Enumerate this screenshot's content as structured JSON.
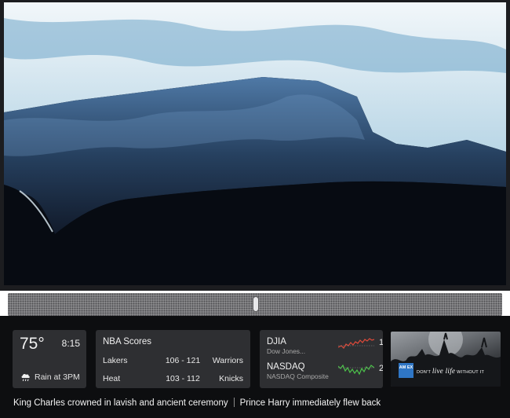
{
  "weather": {
    "temperature": "75°",
    "time": "8:15",
    "forecast": "Rain at 3PM",
    "icon": "rain-cloud-icon"
  },
  "nba": {
    "title": "NBA Scores",
    "games": [
      {
        "home": "Lakers",
        "score": "106 - 121",
        "away": "Warriors"
      },
      {
        "home": "Heat",
        "score": "103 - 112",
        "away": "Knicks"
      }
    ]
  },
  "stocks": [
    {
      "symbol": "DJIA",
      "name": "Dow Jones...",
      "trend_color": "#e04a3a",
      "cut_off_value": "1"
    },
    {
      "symbol": "NASDAQ",
      "name": "NASDAQ Composite",
      "trend_color": "#4cc24a",
      "cut_off_value": "2"
    }
  ],
  "ad": {
    "logo_text": "AM EX",
    "slogan_before": "DON'T ",
    "slogan_script": "live life",
    "slogan_after": " WITHOUT IT",
    "brand_color": "#2f76c5"
  },
  "ticker": {
    "headlines": [
      "King Charles crowned in lavish and ancient ceremony",
      "Prince Harry immediately flew back"
    ]
  }
}
